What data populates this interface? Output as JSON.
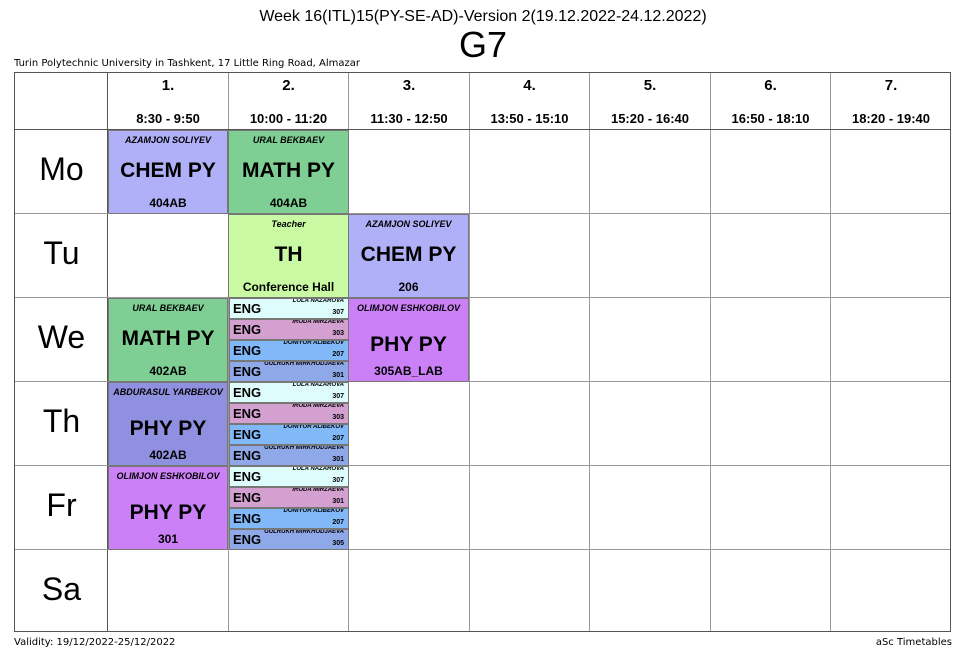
{
  "header": {
    "week": "Week 16(ITL)15(PY-SE-AD)-Version 2(19.12.2022-24.12.2022)",
    "group": "G7",
    "school": "Turin Polytechnic University in Tashkent, 17 Little Ring Road, Almazar"
  },
  "columns": [
    {
      "num": "1.",
      "time": "8:30 - 9:50"
    },
    {
      "num": "2.",
      "time": "10:00 - 11:20"
    },
    {
      "num": "3.",
      "time": "11:30 - 12:50"
    },
    {
      "num": "4.",
      "time": "13:50 - 15:10"
    },
    {
      "num": "5.",
      "time": "15:20 - 16:40"
    },
    {
      "num": "6.",
      "time": "16:50 - 18:10"
    },
    {
      "num": "7.",
      "time": "18:20 - 19:40"
    }
  ],
  "days": [
    "Mo",
    "Tu",
    "We",
    "Th",
    "Fr",
    "Sa"
  ],
  "lessons": {
    "mo1": {
      "teacher": "AZAMJON SOLIYEV",
      "subject": "CHEM PY",
      "room": "404AB",
      "color": "#b0b0f8"
    },
    "mo2": {
      "teacher": "URAL BEKBAEV",
      "subject": "MATH PY",
      "room": "404AB",
      "color": "#7fcf94"
    },
    "tu2": {
      "teacher": "Teacher",
      "subject": "TH",
      "room": "Conference Hall",
      "color": "#c9f9a3"
    },
    "tu3": {
      "teacher": "AZAMJON SOLIYEV",
      "subject": "CHEM PY",
      "room": "206",
      "color": "#b0b0f8"
    },
    "we1": {
      "teacher": "URAL BEKBAEV",
      "subject": "MATH PY",
      "room": "402AB",
      "color": "#7fcf94"
    },
    "we3": {
      "teacher": "OLIMJON ESHKOBILOV",
      "subject": "PHY PY",
      "room": "305AB_LAB",
      "color": "#cc80f8"
    },
    "th1": {
      "teacher": "ABDURASUL YARBEKOV",
      "subject": "PHY PY",
      "room": "402AB",
      "color": "#9090e0"
    },
    "fr1": {
      "teacher": "OLIMJON ESHKOBILOV",
      "subject": "PHY PY",
      "room": "301",
      "color": "#cc80f8"
    }
  },
  "eng": {
    "we": [
      {
        "subject": "ENG",
        "teacher": "LOLA NAZAROVA",
        "room": "307",
        "color": "#dffcfc"
      },
      {
        "subject": "ENG",
        "teacher": "IRODA MIRZAEVA",
        "room": "303",
        "color": "#d3a0d0"
      },
      {
        "subject": "ENG",
        "teacher": "DONIYOR ALIBEKOV",
        "room": "207",
        "color": "#80b8f8"
      },
      {
        "subject": "ENG",
        "teacher": "GULRUKH MIRKHODJAEVA",
        "room": "301",
        "color": "#8fa8e8"
      }
    ],
    "th": [
      {
        "subject": "ENG",
        "teacher": "LOLA NAZAROVA",
        "room": "307",
        "color": "#dffcfc"
      },
      {
        "subject": "ENG",
        "teacher": "IRODA MIRZAEVA",
        "room": "303",
        "color": "#d3a0d0"
      },
      {
        "subject": "ENG",
        "teacher": "DONIYOR ALIBEKOV",
        "room": "207",
        "color": "#80b8f8"
      },
      {
        "subject": "ENG",
        "teacher": "GULRUKH MIRKHODJAEVA",
        "room": "301",
        "color": "#8fa8e8"
      }
    ],
    "fr": [
      {
        "subject": "ENG",
        "teacher": "LOLA NAZAROVA",
        "room": "307",
        "color": "#dffcfc"
      },
      {
        "subject": "ENG",
        "teacher": "IRODA MIRZAEVA",
        "room": "301",
        "color": "#d3a0d0"
      },
      {
        "subject": "ENG",
        "teacher": "DONIYOR ALIBEKOV",
        "room": "207",
        "color": "#80b8f8"
      },
      {
        "subject": "ENG",
        "teacher": "GULRUKH MIRKHODJAEVA",
        "room": "305",
        "color": "#8fa8e8"
      }
    ]
  },
  "footer": {
    "validity": "Validity: 19/12/2022-25/12/2022",
    "credit": "aSc Timetables"
  }
}
